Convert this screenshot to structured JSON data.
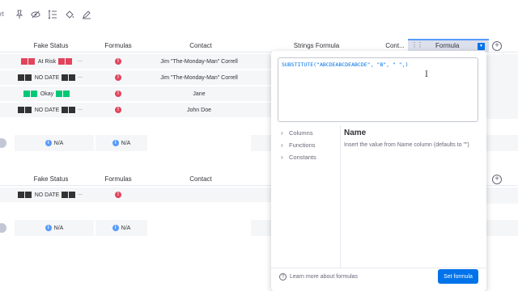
{
  "toolbar": {
    "partial_label": "rt",
    "icons": [
      "pin-icon",
      "eye-off-icon",
      "row-height-icon",
      "paint-bucket-icon",
      "edit-icon"
    ]
  },
  "group1": {
    "headers": {
      "fake_status": "Fake Status",
      "formulas": "Formulas",
      "contact": "Contact",
      "strings_formula": "Strings Formula",
      "cont_short": "Cont...",
      "formula": "Formula"
    },
    "rows": [
      {
        "status": "At Risk",
        "color": "red",
        "formula_error": "!",
        "contact": "Jim \"The-Monday-Man\" Correll"
      },
      {
        "status": "NO DATE",
        "color": "dark",
        "formula_error": "!",
        "contact": "Jim \"The-Monday-Man\" Correll"
      },
      {
        "status": "Okay",
        "color": "green",
        "formula_error": "!",
        "contact": "Jane"
      },
      {
        "status": "NO DATE",
        "color": "dark",
        "formula_error": "!",
        "contact": "John Doe"
      }
    ],
    "summary": {
      "fake_status": "N/A",
      "formulas": "N/A"
    }
  },
  "group2": {
    "headers": {
      "fake_status": "Fake Status",
      "formulas": "Formulas",
      "contact": "Contact"
    },
    "rows": [
      {
        "status": "NO DATE",
        "color": "dark",
        "formula_error": "!",
        "contact": ""
      }
    ],
    "summary": {
      "fake_status": "N/A",
      "formulas": "N/A"
    }
  },
  "ellipsis": "...",
  "add_column": "+",
  "formula_panel": {
    "expression": "SUBSTITUTE(\"ABCDEABCDEABCDE\", \"B\", \" \",)",
    "nav": [
      {
        "label": "Columns"
      },
      {
        "label": "Functions"
      },
      {
        "label": "Constants"
      }
    ],
    "desc_title": "Name",
    "desc_body": "Insert the value from Name column (defaults to \"\")",
    "learn_more": "Learn more about formulas",
    "set_button": "Set formula"
  },
  "colors": {
    "accent": "#0073ea",
    "red": "#e2445c",
    "green": "#00c875",
    "dark": "#333333",
    "info": "#579bfc"
  }
}
